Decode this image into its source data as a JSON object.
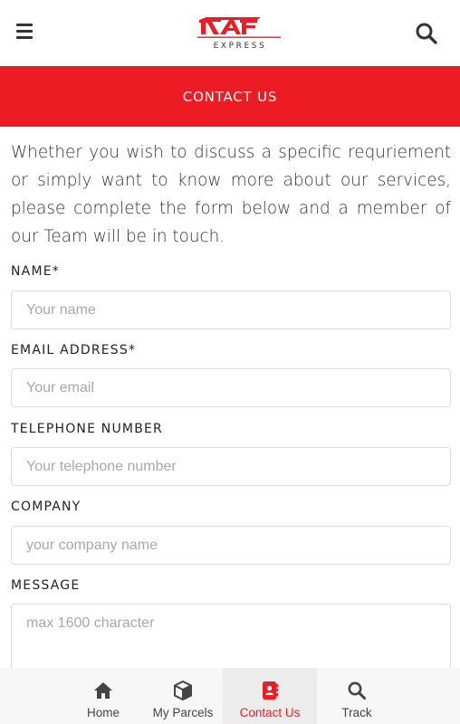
{
  "header": {
    "logo_text": "RAF",
    "logo_sub": "EXPRESS"
  },
  "banner": {
    "title": "CONTACT US"
  },
  "intro": "Whether you wish to discuss a specific requriement or simply want to know more about our services, please complete the form below and a member of our Team will be in touch.",
  "form": {
    "name": {
      "label": "NAME*",
      "placeholder": "Your name"
    },
    "email": {
      "label": "EMAIL ADDRESS*",
      "placeholder": "Your email"
    },
    "phone": {
      "label": "TELEPHONE NUMBER",
      "placeholder": "Your telephone number"
    },
    "company": {
      "label": "COMPANY",
      "placeholder": "your company name"
    },
    "message": {
      "label": "MESSAGE",
      "placeholder": "max 1600 character"
    }
  },
  "tabs": [
    {
      "label": "Home",
      "icon": "home-icon"
    },
    {
      "label": "My Parcels",
      "icon": "box-icon"
    },
    {
      "label": "Contact Us",
      "icon": "contact-book-icon",
      "active": true
    },
    {
      "label": "Track",
      "icon": "search-icon"
    }
  ],
  "colors": {
    "brand": "#ed1c24"
  }
}
